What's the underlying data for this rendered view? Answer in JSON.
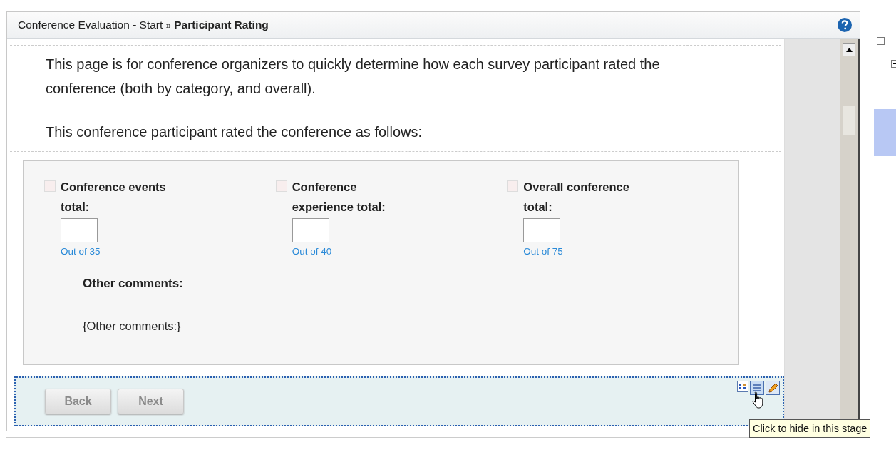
{
  "breadcrumb": {
    "parent": "Conference Evaluation - Start",
    "separator": "»",
    "current": "Participant Rating"
  },
  "intro": [
    "This page is for conference organizers to quickly determine how each survey participant rated the conference (both by category, and overall).",
    "This conference participant rated the conference as follows:"
  ],
  "fields": [
    {
      "label": "Conference events total:",
      "hint": "Out of 35"
    },
    {
      "label": "Conference experience total:",
      "hint": "Out of 40"
    },
    {
      "label": "Overall conference total:",
      "hint": "Out of 75"
    }
  ],
  "comments": {
    "label": "Other comments:",
    "value": "{Other comments:}"
  },
  "buttons": [
    {
      "label": "Back",
      "disabled": true
    },
    {
      "label": "Next",
      "disabled": true
    }
  ],
  "tooltip": "Click to hide in this stage"
}
